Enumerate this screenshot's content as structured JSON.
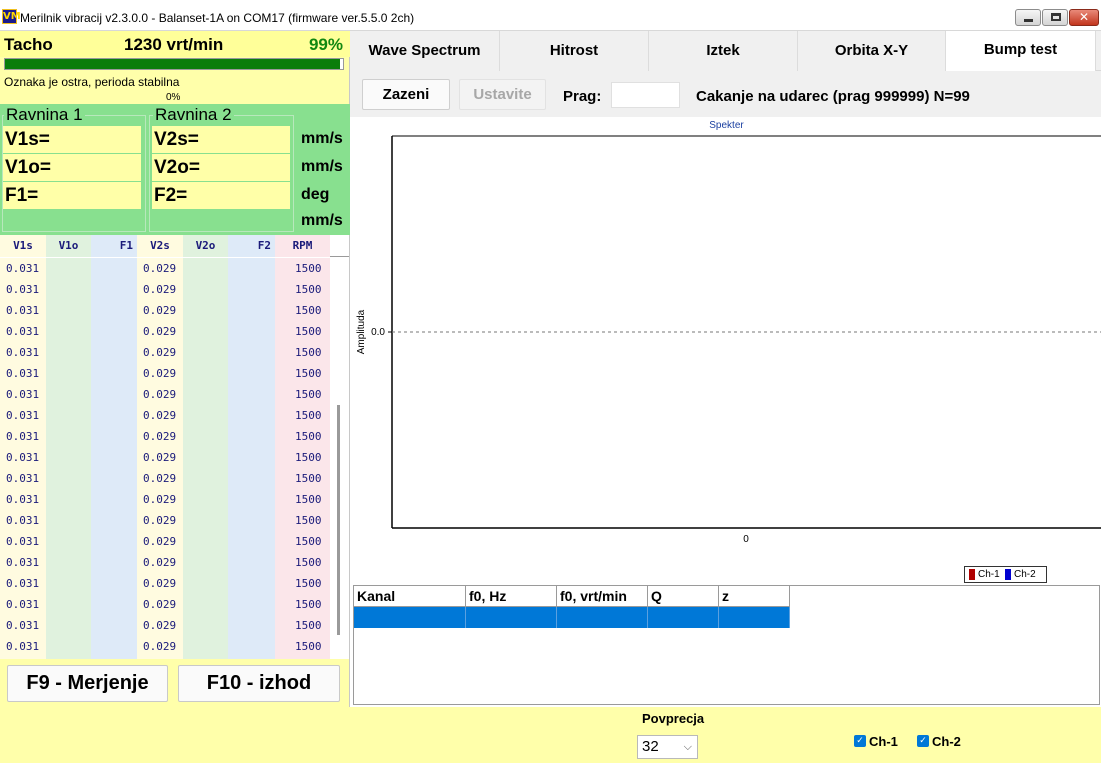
{
  "window": {
    "title": "Merilnik vibracij v2.3.0.0 - Balanset-1A on COM17 (firmware ver.5.5.0 2ch)",
    "icon_text": "VM"
  },
  "tacho": {
    "label": "Tacho",
    "value": "1230 vrt/min",
    "percent": "99%",
    "progress": 0.99,
    "status": "Oznaka je ostra, perioda stabilna",
    "status_percent": "0%"
  },
  "planes": {
    "plane1": {
      "title": "Ravnina 1",
      "v1s": "V1s=",
      "v1o": "V1o=",
      "f1": "F1="
    },
    "plane2": {
      "title": "Ravnina 2",
      "v2s": "V2s=",
      "v2o": "V2o=",
      "f2": "F2="
    },
    "units": [
      "mm/s",
      "mm/s",
      "deg",
      "mm/s"
    ]
  },
  "data_table": {
    "columns": [
      "V1s",
      "V1o",
      "F1",
      "V2s",
      "V2o",
      "F2",
      "RPM"
    ],
    "rows": [
      [
        "0.031",
        "",
        "",
        "0.029",
        "",
        "",
        "1500"
      ],
      [
        "0.031",
        "",
        "",
        "0.029",
        "",
        "",
        "1500"
      ],
      [
        "0.031",
        "",
        "",
        "0.029",
        "",
        "",
        "1500"
      ],
      [
        "0.031",
        "",
        "",
        "0.029",
        "",
        "",
        "1500"
      ],
      [
        "0.031",
        "",
        "",
        "0.029",
        "",
        "",
        "1500"
      ],
      [
        "0.031",
        "",
        "",
        "0.029",
        "",
        "",
        "1500"
      ],
      [
        "0.031",
        "",
        "",
        "0.029",
        "",
        "",
        "1500"
      ],
      [
        "0.031",
        "",
        "",
        "0.029",
        "",
        "",
        "1500"
      ],
      [
        "0.031",
        "",
        "",
        "0.029",
        "",
        "",
        "1500"
      ],
      [
        "0.031",
        "",
        "",
        "0.029",
        "",
        "",
        "1500"
      ],
      [
        "0.031",
        "",
        "",
        "0.029",
        "",
        "",
        "1500"
      ],
      [
        "0.031",
        "",
        "",
        "0.029",
        "",
        "",
        "1500"
      ],
      [
        "0.031",
        "",
        "",
        "0.029",
        "",
        "",
        "1500"
      ],
      [
        "0.031",
        "",
        "",
        "0.029",
        "",
        "",
        "1500"
      ],
      [
        "0.031",
        "",
        "",
        "0.029",
        "",
        "",
        "1500"
      ],
      [
        "0.031",
        "",
        "",
        "0.029",
        "",
        "",
        "1500"
      ],
      [
        "0.031",
        "",
        "",
        "0.029",
        "",
        "",
        "1500"
      ],
      [
        "0.031",
        "",
        "",
        "0.029",
        "",
        "",
        "1500"
      ],
      [
        "0.031",
        "",
        "",
        "0.029",
        "",
        "",
        "1500"
      ]
    ]
  },
  "buttons": {
    "measure": "F9 - Merjenje",
    "exit": "F10 - izhod"
  },
  "tabs": [
    {
      "label": "Wave Spectrum",
      "active": false
    },
    {
      "label": "Hitrost",
      "active": false
    },
    {
      "label": "Iztek",
      "active": false
    },
    {
      "label": "Orbita X-Y",
      "active": false
    },
    {
      "label": "Bump test",
      "active": true
    }
  ],
  "toolbar": {
    "start": "Zazeni",
    "stop": "Ustavite",
    "threshold_label": "Prag:",
    "threshold_value": "",
    "waiting_text": "Cakanje na udarec (prag 999999)  N=99"
  },
  "chart_data": {
    "type": "line",
    "title": "Spekter",
    "xlabel": "",
    "ylabel": "Amplituda",
    "x_ticks": [
      "0"
    ],
    "y_ticks": [
      "0.0"
    ],
    "series": [
      {
        "name": "Ch-1",
        "color": "#b00000",
        "values": []
      },
      {
        "name": "Ch-2",
        "color": "#0000d0",
        "values": []
      }
    ],
    "zero_line": "dashed",
    "legend": "bottom-right"
  },
  "results_table": {
    "columns": [
      "Kanal",
      "f0, Hz",
      "f0, vrt/min",
      "Q",
      "z"
    ],
    "rows": [
      [
        "",
        "",
        "",
        "",
        ""
      ]
    ]
  },
  "bottom": {
    "average_label": "Povprecja",
    "average_value": "32",
    "ch1": {
      "label": "Ch-1",
      "checked": true
    },
    "ch2": {
      "label": "Ch-2",
      "checked": true
    }
  },
  "colors": {
    "yellow_panel": "#ffffaa",
    "green_panel": "#88e08f",
    "progress_green": "#0a7d0a",
    "selection_blue": "#0078d7",
    "table_text": "#1a1a7a"
  }
}
